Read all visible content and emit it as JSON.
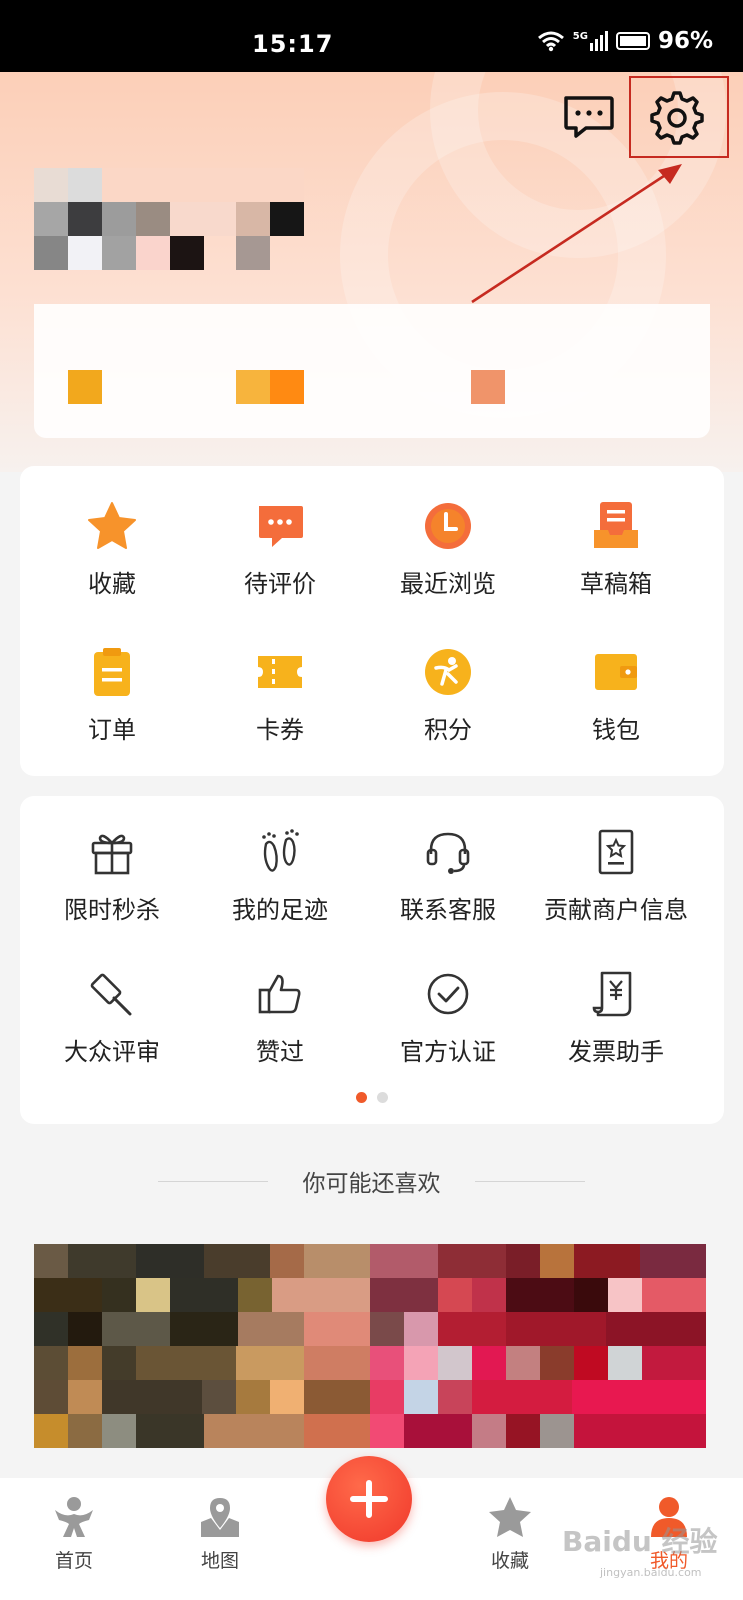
{
  "status_bar": {
    "time": "15:17",
    "network": "5G",
    "battery": "96%"
  },
  "grid1": [
    {
      "label": "收藏",
      "icon": "star-icon"
    },
    {
      "label": "待评价",
      "icon": "comment-icon"
    },
    {
      "label": "最近浏览",
      "icon": "clock-icon"
    },
    {
      "label": "草稿箱",
      "icon": "draft-box-icon"
    },
    {
      "label": "订单",
      "icon": "order-clipboard-icon"
    },
    {
      "label": "卡券",
      "icon": "coupon-ticket-icon"
    },
    {
      "label": "积分",
      "icon": "points-icon"
    },
    {
      "label": "钱包",
      "icon": "wallet-icon"
    }
  ],
  "grid2": [
    {
      "label": "限时秒杀",
      "icon": "gift-icon"
    },
    {
      "label": "我的足迹",
      "icon": "footprint-icon"
    },
    {
      "label": "联系客服",
      "icon": "headset-icon"
    },
    {
      "label": "贡献商户信息",
      "icon": "merchant-info-icon"
    },
    {
      "label": "大众评审",
      "icon": "gavel-icon"
    },
    {
      "label": "赞过",
      "icon": "thumbs-up-icon"
    },
    {
      "label": "官方认证",
      "icon": "check-circle-icon"
    },
    {
      "label": "发票助手",
      "icon": "invoice-icon"
    }
  ],
  "recommend_title": "你可能还喜欢",
  "tabs": {
    "home": "首页",
    "map": "地图",
    "favorites": "收藏",
    "mine": "我的"
  },
  "watermark": {
    "brand": "Baidu 经验",
    "url": "jingyan.baidu.com"
  },
  "colors": {
    "accent": "#f05a2a",
    "icon_orange": "#f7932b",
    "highlight": "#c62a20"
  }
}
